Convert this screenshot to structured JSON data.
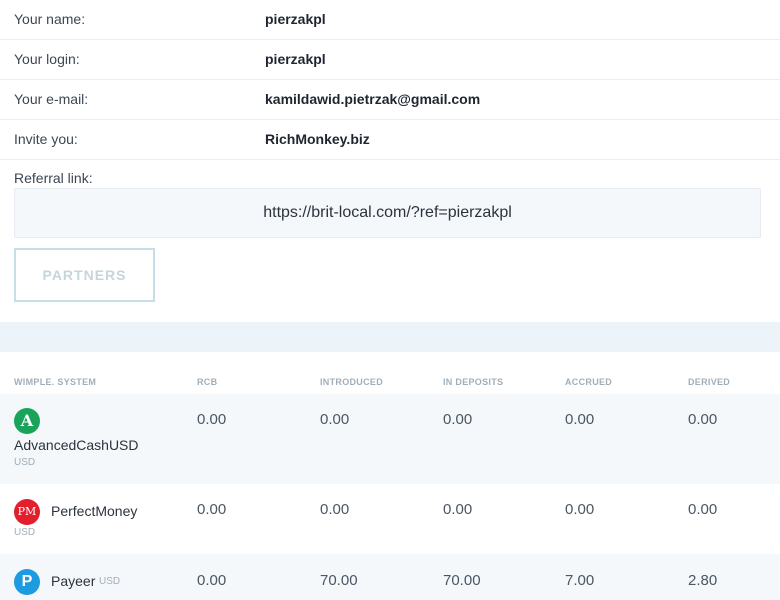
{
  "profile": {
    "rows": [
      {
        "label": "Your name:",
        "value": "pierzakpl"
      },
      {
        "label": "Your login:",
        "value": "pierzakpl"
      },
      {
        "label": "Your e-mail:",
        "value": "kamildawid.pietrzak@gmail.com"
      },
      {
        "label": "Invite you:",
        "value": "RichMonkey.biz"
      }
    ],
    "referral_label": "Referral link:",
    "referral_link": "https://brit-local.com/?ref=pierzakpl",
    "partners_button": "PARTNERS"
  },
  "table": {
    "headers": {
      "system": "WIMPLE. SYSTEM",
      "rcb": "RCB",
      "introduced": "INTRODUCED",
      "in_deposits": "IN DEPOSITS",
      "accrued": "ACCRUED",
      "derived": "DERIVED"
    },
    "rows": [
      {
        "name": "AdvancedCashUSD",
        "currency": "USD",
        "icon": "advcash-icon",
        "icon_glyph": "A",
        "rcb": "0.00",
        "introduced": "0.00",
        "in_deposits": "0.00",
        "accrued": "0.00",
        "derived": "0.00"
      },
      {
        "name": "PerfectMoney",
        "currency": "USD",
        "icon": "perfectmoney-icon",
        "icon_glyph": "PM",
        "rcb": "0.00",
        "introduced": "0.00",
        "in_deposits": "0.00",
        "accrued": "0.00",
        "derived": "0.00"
      },
      {
        "name": "Payeer",
        "currency": "USD",
        "icon": "payeer-icon",
        "icon_glyph": "P",
        "rcb": "0.00",
        "introduced": "70.00",
        "in_deposits": "70.00",
        "accrued": "7.00",
        "derived": "2.80"
      }
    ]
  },
  "colors": {
    "advcash": "#1aa35a",
    "perfectmoney": "#e41f2d",
    "payeer": "#1d9be0"
  }
}
